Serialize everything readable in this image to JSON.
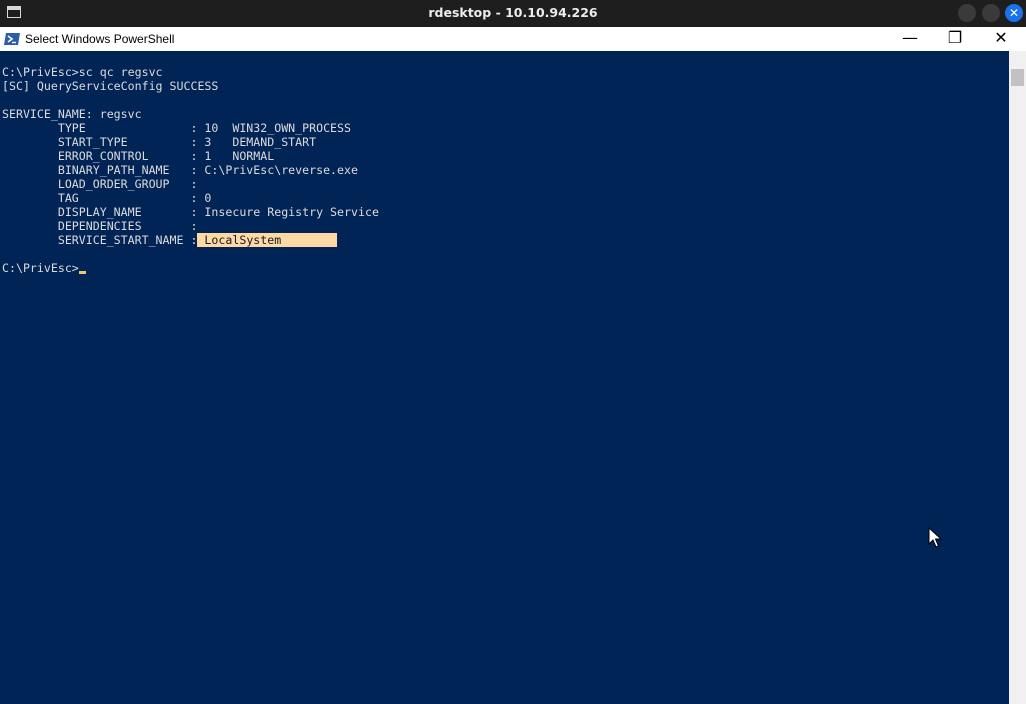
{
  "outer_window": {
    "title": "rdesktop - 10.10.94.226",
    "close_glyph": "✕"
  },
  "window": {
    "title": "Select Windows PowerShell",
    "minimize_glyph": "—",
    "restore_glyph": "❐",
    "close_glyph": "✕"
  },
  "console": {
    "lines": [
      "C:\\PrivEsc>sc qc regsvc",
      "[SC] QueryServiceConfig SUCCESS",
      "",
      "SERVICE_NAME: regsvc",
      "        TYPE               : 10  WIN32_OWN_PROCESS",
      "        START_TYPE         : 3   DEMAND_START",
      "        ERROR_CONTROL      : 1   NORMAL",
      "        BINARY_PATH_NAME   : C:\\PrivEsc\\reverse.exe",
      "        LOAD_ORDER_GROUP   :",
      "        TAG                : 0",
      "        DISPLAY_NAME       : Insecure Registry Service",
      "        DEPENDENCIES       :",
      "        SERVICE_START_NAME :"
    ],
    "highlighted_value": " LocalSystem        ",
    "blank_line": "",
    "prompt": "C:\\PrivEsc>"
  },
  "colors": {
    "console_background": "#012456",
    "console_text": "#dcdcdc",
    "highlight_background": "#fdd9a6",
    "outer_close_button": "#1a73e8"
  },
  "icons": {
    "app_icon": "window-icon",
    "powershell_icon": "powershell-icon",
    "pointer": "mouse-pointer-icon"
  }
}
